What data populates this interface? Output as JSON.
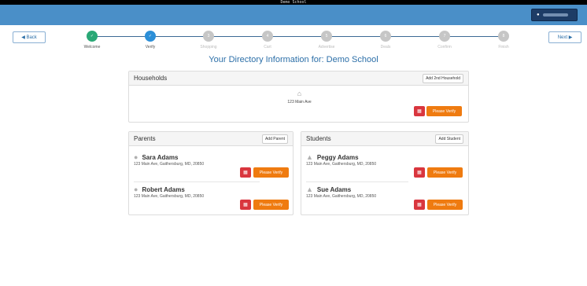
{
  "window": {
    "title": "Demo School"
  },
  "user": {
    "icon": "user-icon"
  },
  "nav": {
    "back_label": "◀ Back",
    "next_label": "Next ▶"
  },
  "steps": [
    {
      "label": "Welcome",
      "state": "done"
    },
    {
      "label": "Verify",
      "state": "active"
    },
    {
      "label": "Shopping",
      "state": "todo",
      "num": "3"
    },
    {
      "label": "Cart",
      "state": "todo",
      "num": "4"
    },
    {
      "label": "Advertise",
      "state": "todo",
      "num": "5"
    },
    {
      "label": "Deals",
      "state": "todo",
      "num": "6"
    },
    {
      "label": "Confirm",
      "state": "todo",
      "num": "7"
    },
    {
      "label": "Finish",
      "state": "todo",
      "num": "8"
    }
  ],
  "heading": "Your Directory Information for: Demo School",
  "households": {
    "title": "Households",
    "add_label": "Add 2nd Household",
    "address": "123 Main Ave",
    "verify_label": "Please Verify"
  },
  "parents": {
    "title": "Parents",
    "add_label": "Add Parent",
    "items": [
      {
        "name": "Sara Adams",
        "address": "123 Main Ave, Gaithersburg, MD, 20850",
        "verify_label": "Please Verify"
      },
      {
        "name": "Robert Adams",
        "address": "123 Main Ave, Gaithersburg, MD, 20850",
        "verify_label": "Please Verify"
      }
    ]
  },
  "students": {
    "title": "Students",
    "add_label": "Add Student",
    "items": [
      {
        "name": "Peggy Adams",
        "address": "123 Main Ave, Gaithersburg, MD, 20850",
        "verify_label": "Please Verify"
      },
      {
        "name": "Sue Adams",
        "address": "123 Main Ave, Gaithersburg, MD, 20850",
        "verify_label": "Please Verify"
      }
    ]
  },
  "colors": {
    "topbar": "#4a8fc8",
    "accent": "#2c6fa8",
    "verify": "#ef7b10",
    "delete": "#d9363e",
    "done": "#2aa876"
  }
}
